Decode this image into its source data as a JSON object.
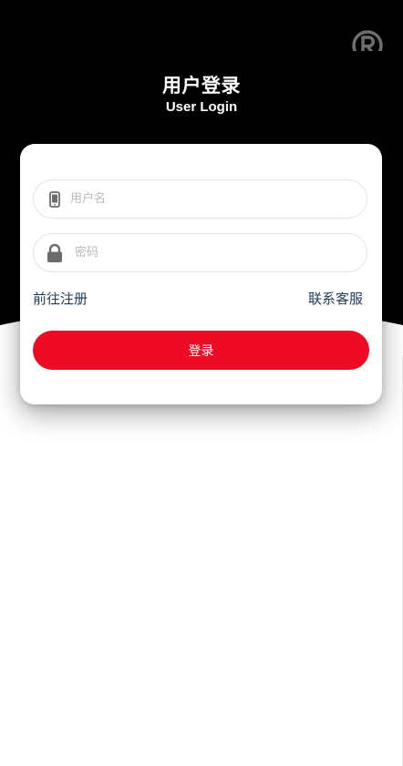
{
  "header": {
    "title_cn": "用户登录",
    "title_en": "User Login",
    "logo_icon": "registered-r-logo-icon"
  },
  "form": {
    "username": {
      "placeholder": "用户名",
      "value": "",
      "icon": "mobile-phone-icon"
    },
    "password": {
      "placeholder": "密码",
      "value": "",
      "icon": "lock-icon"
    },
    "register_link": "前往注册",
    "support_link": "联系客服",
    "login_button": "登录"
  },
  "colors": {
    "hero_bg": "#000000",
    "primary_button": "#ee0b26",
    "link": "#1f3a5f",
    "icon": "#6b6b6b"
  }
}
